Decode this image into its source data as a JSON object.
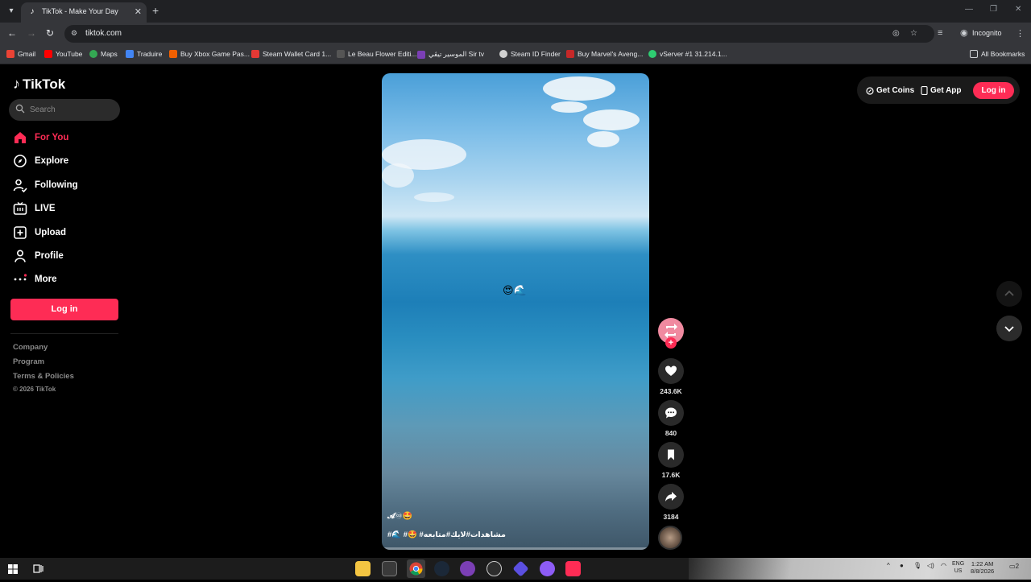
{
  "browser": {
    "tab_title": "TikTok - Make Your Day",
    "url": "tiktok.com",
    "incognito_label": "Incognito",
    "all_bookmarks": "All Bookmarks",
    "bookmarks": [
      {
        "label": "Gmail",
        "icon": "gmail-icon",
        "color": "#ea4335"
      },
      {
        "label": "YouTube",
        "icon": "youtube-icon",
        "color": "#ff0000"
      },
      {
        "label": "Maps",
        "icon": "maps-icon",
        "color": "#34a853"
      },
      {
        "label": "Traduire",
        "icon": "translate-icon",
        "color": "#4285f4"
      },
      {
        "label": "Buy Xbox Game Pas...",
        "icon": "g2a-icon",
        "color": "#f05f00"
      },
      {
        "label": "Steam Wallet Card 1...",
        "icon": "store-icon",
        "color": "#e53935"
      },
      {
        "label": "Le Beau Flower Editi...",
        "icon": "flower-icon",
        "color": "#333333"
      },
      {
        "label": "الموسير تيڤي Sir tv",
        "icon": "sirtv-icon",
        "color": "#7b3fb5"
      },
      {
        "label": "Steam ID Finder",
        "icon": "steam-id-icon",
        "color": "#d0d0d0"
      },
      {
        "label": "Buy Marvel's Aveng...",
        "icon": "marvel-icon",
        "color": "#c62828"
      },
      {
        "label": "vServer #1 31.214.1...",
        "icon": "vserver-icon",
        "color": "#2ecc71"
      }
    ]
  },
  "sidebar": {
    "logo": "TikTok",
    "search_placeholder": "Search",
    "nav": [
      {
        "label": "For You",
        "icon": "home-icon",
        "active": true
      },
      {
        "label": "Explore",
        "icon": "compass-icon"
      },
      {
        "label": "Following",
        "icon": "following-icon"
      },
      {
        "label": "LIVE",
        "icon": "live-icon"
      },
      {
        "label": "Upload",
        "icon": "upload-icon"
      },
      {
        "label": "Profile",
        "icon": "profile-icon"
      },
      {
        "label": "More",
        "icon": "more-icon"
      }
    ],
    "login_label": "Log in",
    "footer": [
      "Company",
      "Program",
      "Terms & Policies"
    ],
    "copyright": "© 2026 TikTok"
  },
  "video": {
    "center_emoji": "😍🌊",
    "tags_line": "𝓐♾🤩",
    "description": "#🌊 #🤩 #مشاهدات#لايك#متابعه",
    "likes": "243.6K",
    "comments": "840",
    "saves": "17.6K",
    "shares": "3184"
  },
  "header": {
    "get_coins": "Get Coins",
    "get_app": "Get App",
    "login": "Log in"
  },
  "taskbar": {
    "lang": "ENG",
    "region": "US",
    "time": "1:22 AM",
    "date": "8/8/2026",
    "notif_count": "2"
  },
  "colors": {
    "accent": "#fe2c55",
    "page_bg": "#000000",
    "chrome_bg": "#35363a"
  }
}
